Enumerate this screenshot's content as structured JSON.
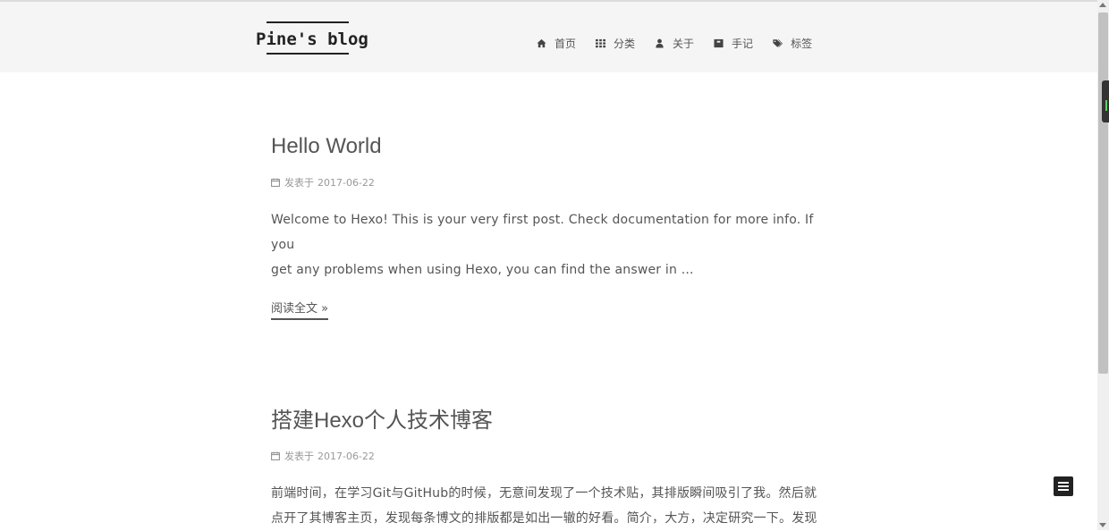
{
  "site": {
    "title": "Pine's blog"
  },
  "nav": {
    "items": [
      {
        "label": "首页",
        "icon": "home-icon"
      },
      {
        "label": "分类",
        "icon": "grid-icon"
      },
      {
        "label": "关于",
        "icon": "user-icon"
      },
      {
        "label": "手记",
        "icon": "archive-icon"
      },
      {
        "label": "标签",
        "icon": "tags-icon"
      }
    ]
  },
  "posts": [
    {
      "title": "Hello World",
      "meta_prefix": "发表于",
      "date": "2017-06-22",
      "excerpt_line1": "Welcome to Hexo! This is your very first post. Check documentation for more info. If you",
      "excerpt_line2": "get any problems when using Hexo, you can find the answer in ...",
      "read_more": "阅读全文 »"
    },
    {
      "title": "搭建Hexo个人技术博客",
      "meta_prefix": "发表于",
      "date": "2017-06-22",
      "excerpt_line1": "前端时间，在学习Git与GitHub的时候，无意间发现了一个技术贴，其排版瞬间吸引了我。然后就",
      "excerpt_line2": "点开了其博客主页，发现每条博文的排版都是如出一辙的好看。简介，大方，决定研究一下。发现"
    }
  ]
}
